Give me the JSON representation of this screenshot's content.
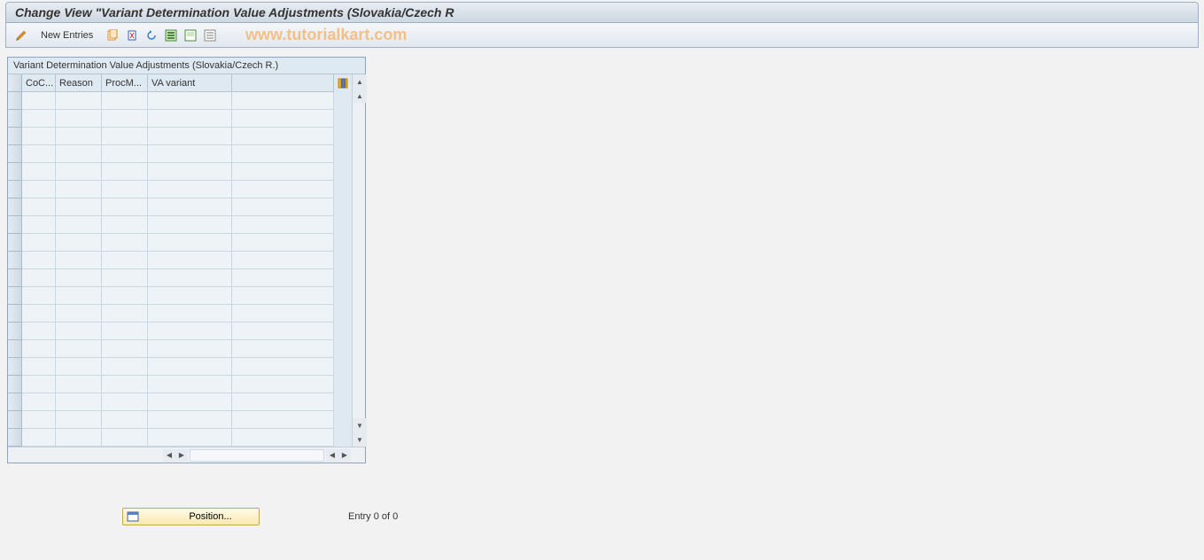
{
  "header": {
    "title": "Change View \"Variant Determination Value Adjustments (Slovakia/Czech R"
  },
  "toolbar": {
    "new_entries_label": "New Entries"
  },
  "watermark": "www.tutorialkart.com",
  "table": {
    "title": "Variant Determination Value Adjustments (Slovakia/Czech R.)",
    "columns": {
      "coc": "CoC...",
      "reason": "Reason",
      "procm": "ProcM...",
      "va": "VA variant"
    },
    "visible_row_count": 20
  },
  "footer": {
    "position_label": "Position...",
    "entry_text": "Entry 0 of 0"
  }
}
